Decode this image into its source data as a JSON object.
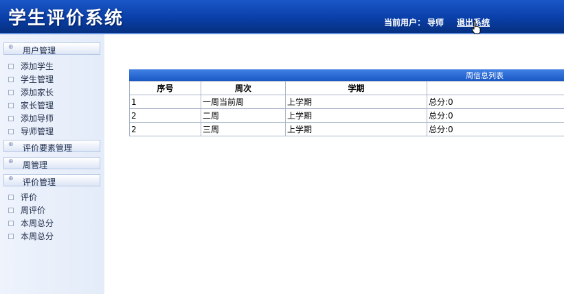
{
  "header": {
    "app_title": "学生评价系统",
    "current_user_label": "当前用户：",
    "current_user_name": "导师",
    "logout_label": "退出系统"
  },
  "sidebar": {
    "groups": [
      {
        "label": "用户管理",
        "items": [
          {
            "label": "添加学生"
          },
          {
            "label": "学生管理"
          },
          {
            "label": "添加家长"
          },
          {
            "label": "家长管理"
          },
          {
            "label": "添加导师"
          },
          {
            "label": "导师管理"
          }
        ]
      },
      {
        "label": "评价要素管理",
        "items": []
      },
      {
        "label": "周管理",
        "items": []
      },
      {
        "label": "评价管理",
        "items": [
          {
            "label": "评价"
          },
          {
            "label": "周评价"
          },
          {
            "label": "本周总分"
          },
          {
            "label": "本周总分"
          }
        ]
      }
    ]
  },
  "week_table": {
    "caption": "周信息列表",
    "columns": [
      "序号",
      "周次",
      "学期",
      ""
    ],
    "rows": [
      [
        "1",
        "一周当前周",
        "上学期",
        "总分:0"
      ],
      [
        "2",
        "二周",
        "上学期",
        "总分:0"
      ],
      [
        "2",
        "三周",
        "上学期",
        "总分:0"
      ]
    ]
  }
}
